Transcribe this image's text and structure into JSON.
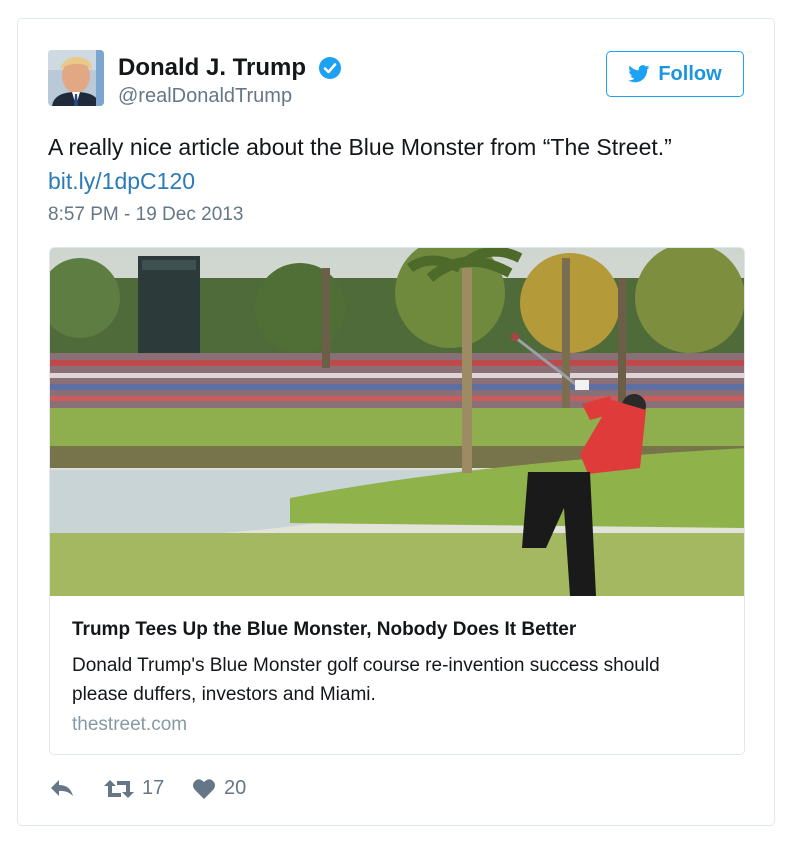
{
  "author": {
    "name": "Donald J. Trump",
    "handle": "@realDonaldTrump",
    "verified": true
  },
  "follow_button": {
    "label": "Follow",
    "icon": "twitter-bird-icon"
  },
  "tweet": {
    "text": "A really nice article about the Blue Monster from “The Street.”",
    "link": "bit.ly/1dpC120",
    "timestamp": "8:57 PM - 19 Dec 2013"
  },
  "card": {
    "title": "Trump Tees Up the Blue Monster, Nobody Does It Better",
    "description": "Donald Trump's Blue Monster golf course re-invention success should please duffers, investors and Miami.",
    "domain": "thestreet.com"
  },
  "actions": {
    "reply": {
      "icon": "reply-icon"
    },
    "retweet": {
      "icon": "retweet-icon",
      "count": "17"
    },
    "like": {
      "icon": "heart-icon",
      "count": "20"
    }
  },
  "colors": {
    "accent": "#1da1f2",
    "link": "#2b7bb9",
    "muted": "#657786"
  }
}
